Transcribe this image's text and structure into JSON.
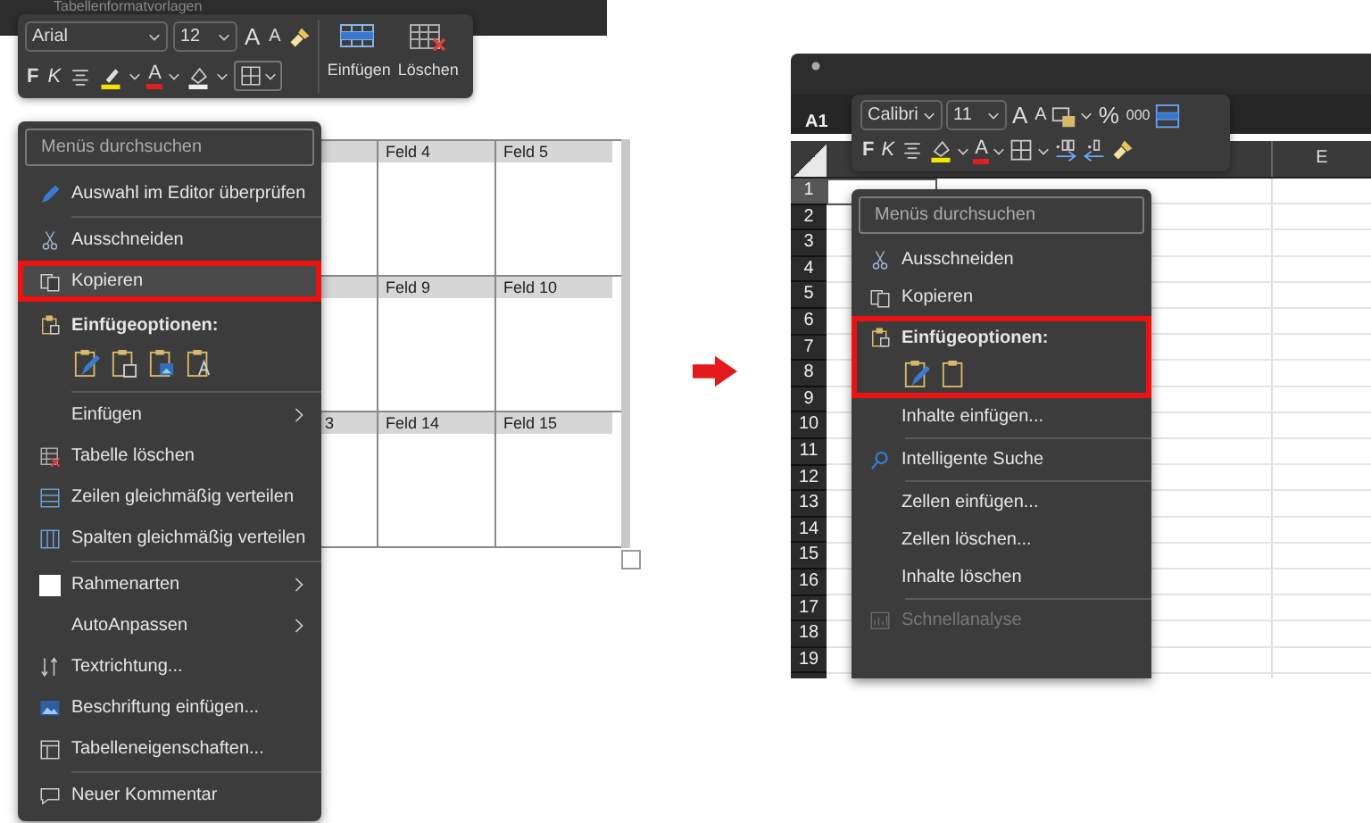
{
  "word": {
    "top_bar": "Tabellenformatvorlagen",
    "toolbar": {
      "font": "Arial",
      "size": "12",
      "grow_font": "A",
      "shrink_font": "A",
      "bold": "F",
      "italic": "K",
      "font_color": "A",
      "insert_label": "Einfügen",
      "delete_label": "Löschen"
    },
    "table": {
      "rows": [
        {
          "cells": [
            "Feld 4",
            "Feld 5"
          ]
        },
        {
          "cells": [
            "Feld 9",
            "Feld 10"
          ]
        },
        {
          "cut_cell": "3",
          "cells": [
            "Feld 14",
            "Feld 15"
          ]
        }
      ]
    },
    "menu": {
      "search_placeholder": "Menüs durchsuchen",
      "items": [
        {
          "kind": "command",
          "label": "Auswahl im Editor überprüfen",
          "submenu": false,
          "highlighted": false
        },
        {
          "kind": "separator"
        },
        {
          "kind": "command",
          "label": "Ausschneiden",
          "submenu": false,
          "highlighted": false
        },
        {
          "kind": "command",
          "label": "Kopieren",
          "submenu": false,
          "highlighted": true
        },
        {
          "kind": "paste-options",
          "label": "Einfügeoptionen:",
          "highlighted": false
        },
        {
          "kind": "separator"
        },
        {
          "kind": "command",
          "label": "Einfügen",
          "submenu": true,
          "highlighted": false
        },
        {
          "kind": "command",
          "label": "Tabelle löschen",
          "submenu": false,
          "highlighted": false
        },
        {
          "kind": "command",
          "label": "Zeilen gleichmäßig verteilen",
          "submenu": false,
          "highlighted": false
        },
        {
          "kind": "command",
          "label": "Spalten gleichmäßig verteilen",
          "submenu": false,
          "highlighted": false
        },
        {
          "kind": "separator"
        },
        {
          "kind": "command",
          "label": "Rahmenarten",
          "submenu": true,
          "highlighted": false
        },
        {
          "kind": "command",
          "label": "AutoAnpassen",
          "submenu": true,
          "highlighted": false
        },
        {
          "kind": "command",
          "label": "Textrichtung...",
          "submenu": false,
          "highlighted": false
        },
        {
          "kind": "command",
          "label": "Beschriftung einfügen...",
          "submenu": false,
          "highlighted": false
        },
        {
          "kind": "command",
          "label": "Tabelleneigenschaften...",
          "submenu": false,
          "highlighted": false
        },
        {
          "kind": "separator"
        },
        {
          "kind": "command",
          "label": "Neuer Kommentar",
          "submenu": false,
          "highlighted": false
        }
      ]
    }
  },
  "excel": {
    "name_box": "A1",
    "column_header": "E",
    "row_headers": [
      "1",
      "2",
      "3",
      "4",
      "5",
      "6",
      "7",
      "8",
      "9",
      "10",
      "11",
      "12",
      "13",
      "14",
      "15",
      "16",
      "17",
      "18",
      "19"
    ],
    "toolbar": {
      "font": "Calibri",
      "size": "11",
      "grow_font": "A",
      "shrink_font": "A",
      "percent": "%",
      "thousands": "000",
      "bold": "F",
      "italic": "K",
      "font_color": "A"
    },
    "menu": {
      "search_placeholder": "Menüs durchsuchen",
      "items": [
        {
          "kind": "command",
          "label": "Ausschneiden",
          "highlighted": false,
          "disabled": false
        },
        {
          "kind": "command",
          "label": "Kopieren",
          "highlighted": false,
          "disabled": false
        },
        {
          "kind": "paste-options",
          "label": "Einfügeoptionen:",
          "highlighted": true
        },
        {
          "kind": "command",
          "label": "Inhalte einfügen...",
          "highlighted": false,
          "disabled": false
        },
        {
          "kind": "separator"
        },
        {
          "kind": "command",
          "label": "Intelligente Suche",
          "highlighted": false,
          "disabled": false
        },
        {
          "kind": "separator"
        },
        {
          "kind": "command",
          "label": "Zellen einfügen...",
          "highlighted": false,
          "disabled": false
        },
        {
          "kind": "command",
          "label": "Zellen löschen...",
          "highlighted": false,
          "disabled": false
        },
        {
          "kind": "command",
          "label": "Inhalte löschen",
          "highlighted": false,
          "disabled": false
        },
        {
          "kind": "separator"
        },
        {
          "kind": "command",
          "label": "Schnellanalyse",
          "highlighted": false,
          "disabled": true
        }
      ]
    }
  }
}
